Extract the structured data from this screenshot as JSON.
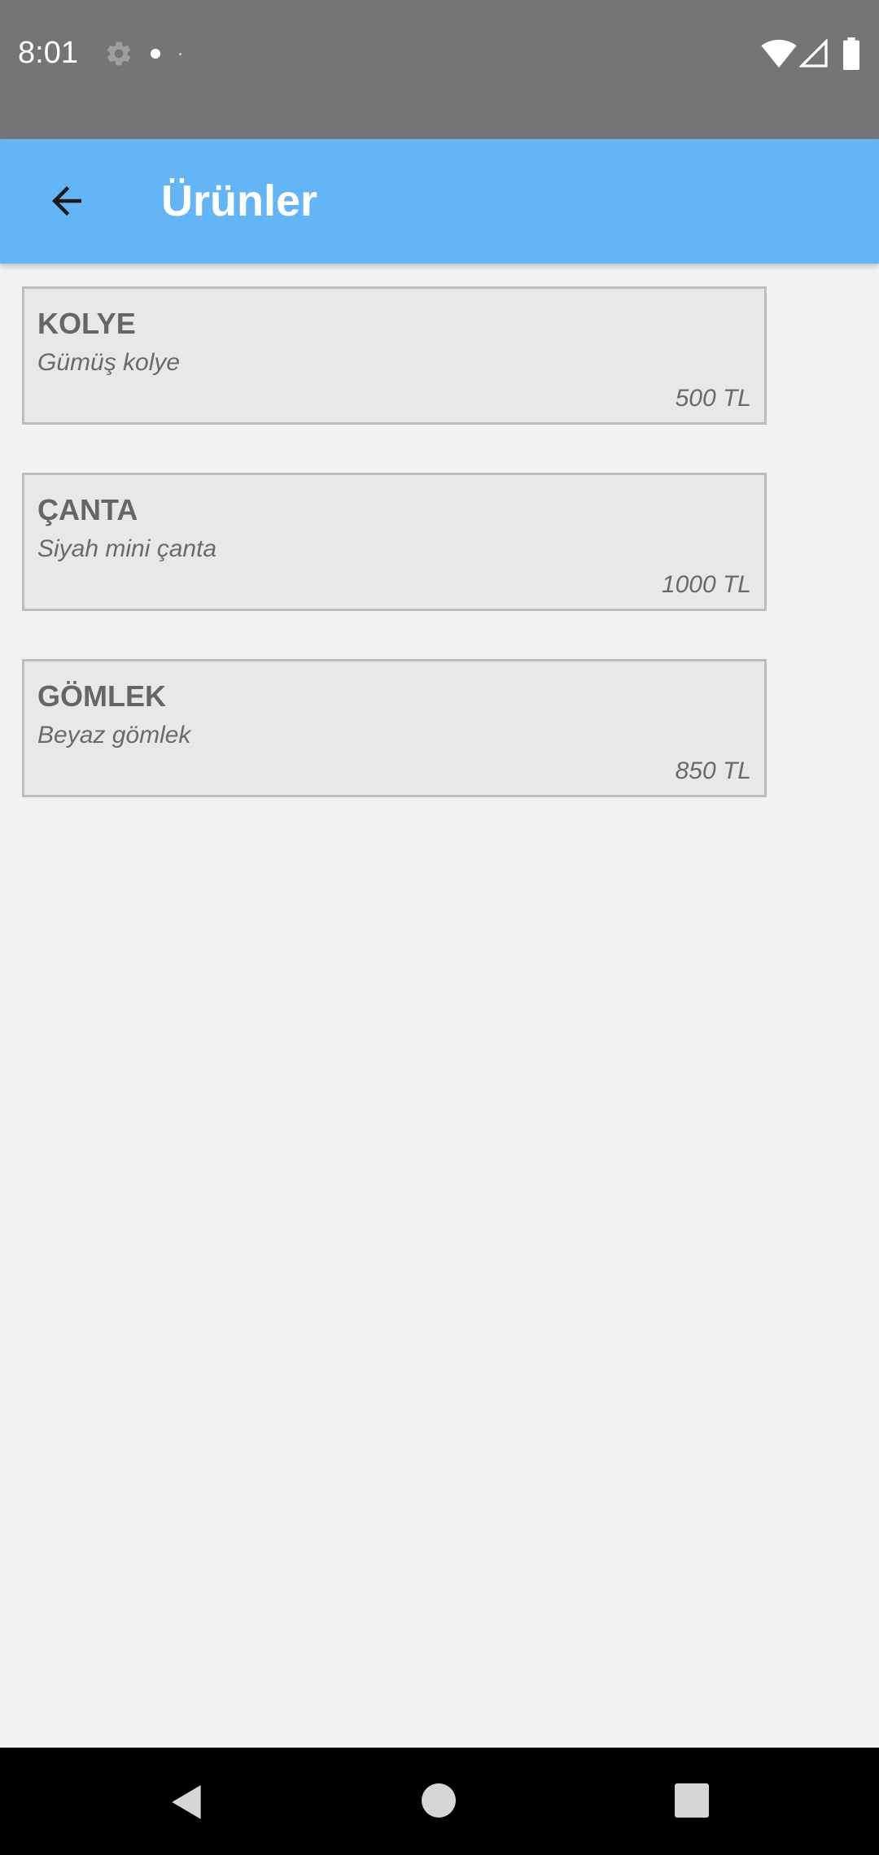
{
  "status_bar": {
    "time": "8:01",
    "icons": [
      "gear-icon",
      "notification-dot-icon",
      "wifi-icon",
      "signal-icon",
      "battery-icon"
    ]
  },
  "app_bar": {
    "title": "Ürünler",
    "back_icon": "arrow-back-icon",
    "background_color": "#64b5f6"
  },
  "products": [
    {
      "name": "KOLYE",
      "description": "Gümüş kolye",
      "price": "500 TL"
    },
    {
      "name": "ÇANTA",
      "description": "Siyah mini çanta",
      "price": "1000 TL"
    },
    {
      "name": "GÖMLEK",
      "description": "Beyaz gömlek",
      "price": "850 TL"
    }
  ],
  "nav_bar": {
    "icons": [
      "nav-back-icon",
      "nav-home-icon",
      "nav-recents-icon"
    ]
  }
}
